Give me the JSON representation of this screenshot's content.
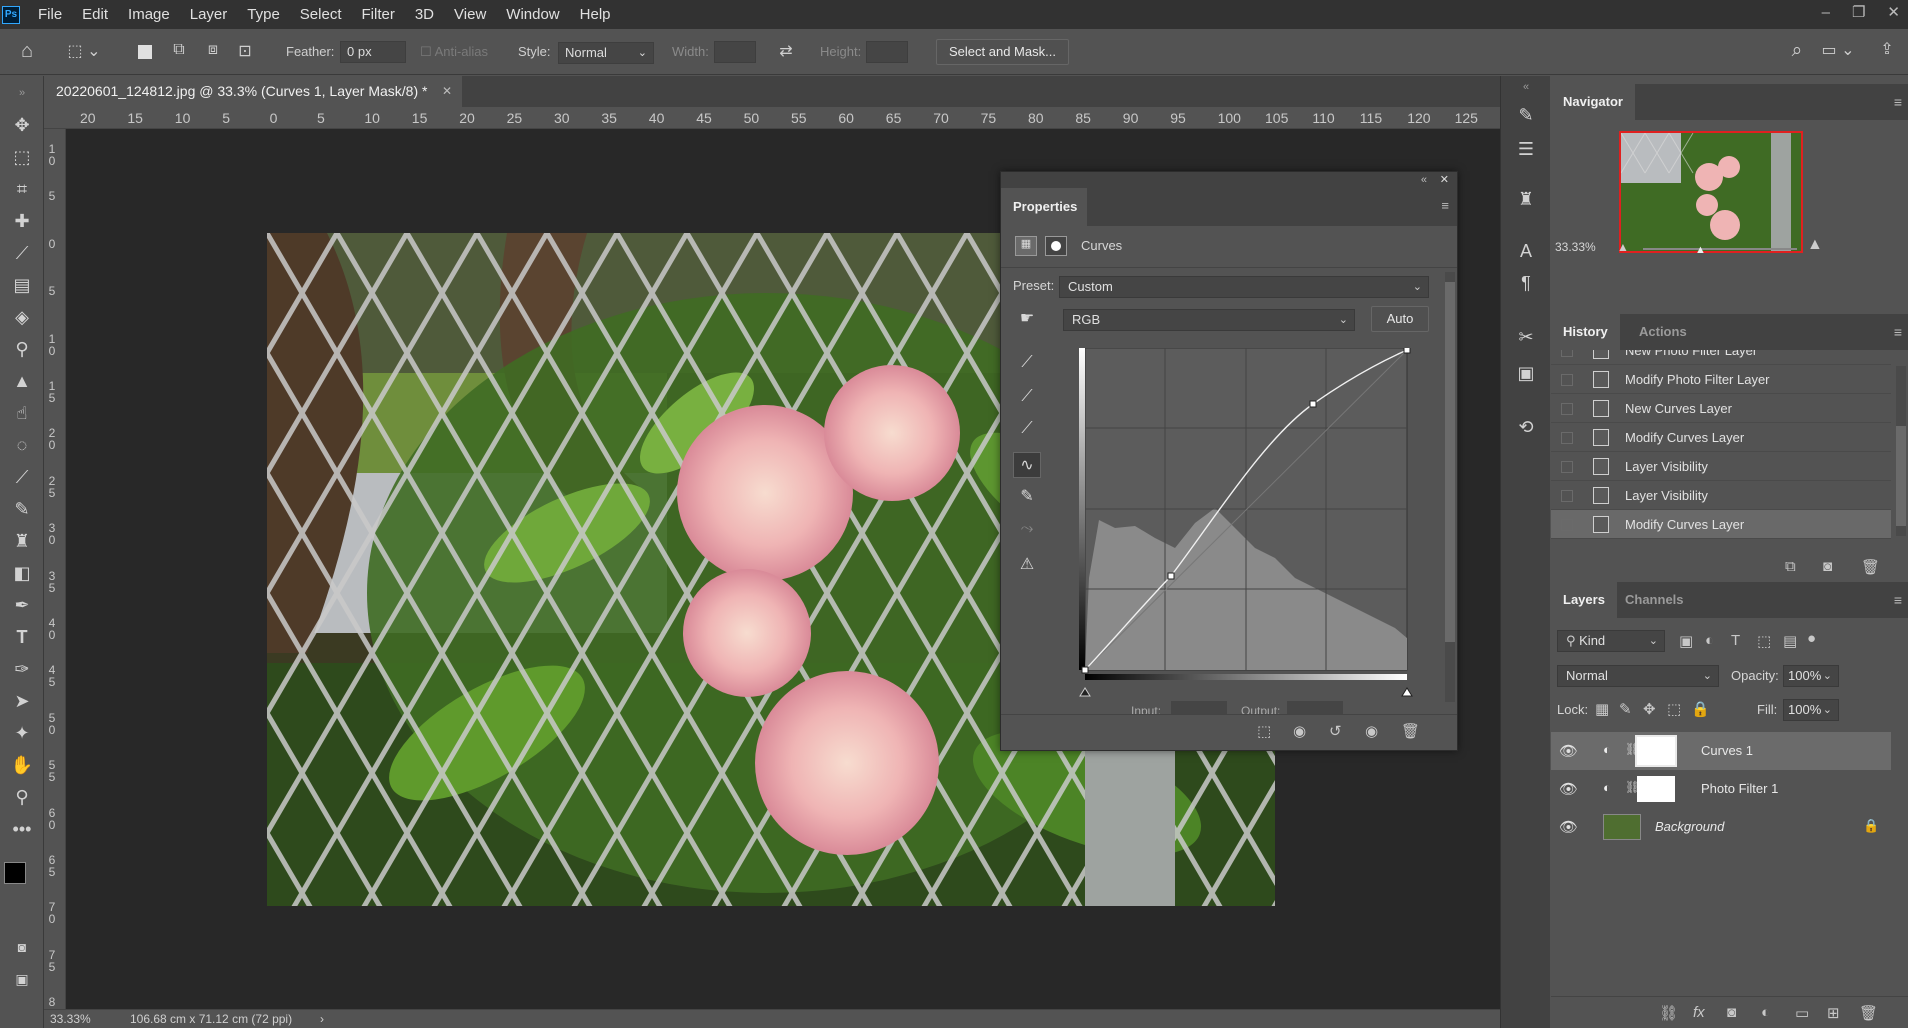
{
  "menubar": {
    "logo": "Ps",
    "items": [
      "File",
      "Edit",
      "Image",
      "Layer",
      "Type",
      "Select",
      "Filter",
      "3D",
      "View",
      "Window",
      "Help"
    ],
    "controls": [
      "–",
      "❐",
      "✕"
    ]
  },
  "options": {
    "feather_label": "Feather:",
    "feather_value": "0 px",
    "anti_alias_label": "Anti-alias",
    "style_label": "Style:",
    "style_value": "Normal",
    "width_label": "Width:",
    "height_label": "Height:",
    "select_mask_label": "Select and Mask..."
  },
  "document": {
    "tab_title": "20220601_124812.jpg @ 33.3% (Curves 1, Layer Mask/8) *",
    "tab_close": "✕"
  },
  "ruler": {
    "h_ticks": [
      "20",
      "15",
      "10",
      "5",
      "0",
      "5",
      "10",
      "15",
      "20",
      "25",
      "30",
      "35",
      "40",
      "45",
      "50",
      "55",
      "60",
      "65",
      "70",
      "75",
      "80",
      "85",
      "90",
      "95",
      "100",
      "105",
      "110",
      "115",
      "120",
      "125"
    ],
    "v_ticks": [
      "1 0",
      "5",
      "0",
      "5",
      "1 0",
      "1 5",
      "2 0",
      "2 5",
      "3 0",
      "3 5",
      "4 0",
      "4 5",
      "5 0",
      "5 5",
      "6 0",
      "6 5",
      "7 0",
      "7 5",
      "8"
    ]
  },
  "status": {
    "zoom": "33.33%",
    "dimensions": "106.68 cm x 71.12 cm (72 ppi)",
    "arrow": "›"
  },
  "properties": {
    "title": "Properties",
    "adjustment_name": "Curves",
    "preset_label": "Preset:",
    "preset_value": "Custom",
    "channel_value": "RGB",
    "auto_label": "Auto",
    "input_label": "Input:",
    "output_label": "Output:"
  },
  "navigator": {
    "title": "Navigator",
    "zoom": "33.33%"
  },
  "history": {
    "tabs": [
      "History",
      "Actions"
    ],
    "items": [
      "New Photo Filter Layer",
      "Modify Photo Filter Layer",
      "New Curves Layer",
      "Modify Curves Layer",
      "Layer Visibility",
      "Layer Visibility",
      "Modify Curves Layer"
    ]
  },
  "layers": {
    "tabs": [
      "Layers",
      "Channels"
    ],
    "kind_label": "Kind",
    "blend_mode": "Normal",
    "opacity_label": "Opacity:",
    "opacity_value": "100%",
    "lock_label": "Lock:",
    "fill_label": "Fill:",
    "fill_value": "100%",
    "items": [
      "Curves 1",
      "Photo Filter 1",
      "Background"
    ]
  }
}
